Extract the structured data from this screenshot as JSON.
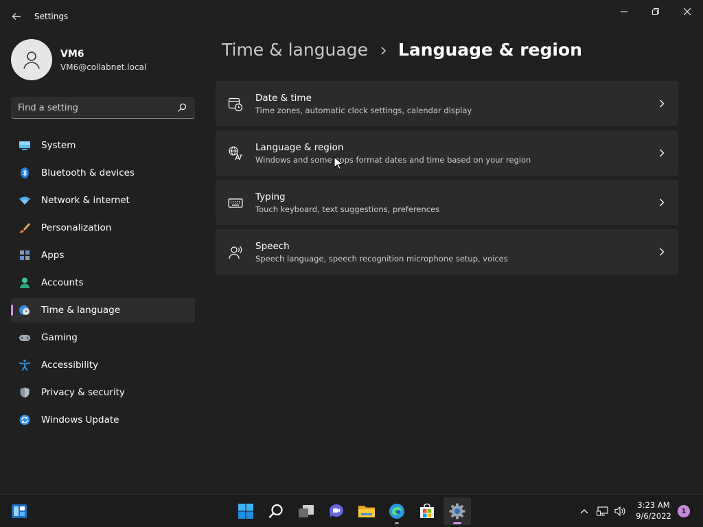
{
  "window": {
    "title": "Settings"
  },
  "profile": {
    "name": "VM6",
    "email": "VM6@collabnet.local"
  },
  "search": {
    "placeholder": "Find a setting"
  },
  "sidebar": {
    "items": [
      {
        "label": "System",
        "icon": "system-icon",
        "selected": false
      },
      {
        "label": "Bluetooth & devices",
        "icon": "bluetooth-icon",
        "selected": false
      },
      {
        "label": "Network & internet",
        "icon": "wifi-icon",
        "selected": false
      },
      {
        "label": "Personalization",
        "icon": "brush-icon",
        "selected": false
      },
      {
        "label": "Apps",
        "icon": "apps-icon",
        "selected": false
      },
      {
        "label": "Accounts",
        "icon": "person-icon",
        "selected": false
      },
      {
        "label": "Time & language",
        "icon": "globe-clock-icon",
        "selected": true
      },
      {
        "label": "Gaming",
        "icon": "gamepad-icon",
        "selected": false
      },
      {
        "label": "Accessibility",
        "icon": "accessibility-icon",
        "selected": false
      },
      {
        "label": "Privacy & security",
        "icon": "shield-icon",
        "selected": false
      },
      {
        "label": "Windows Update",
        "icon": "update-icon",
        "selected": false
      }
    ]
  },
  "breadcrumb": {
    "parent": "Time & language",
    "current": "Language & region"
  },
  "cards": [
    {
      "title": "Date & time",
      "description": "Time zones, automatic clock settings, calendar display",
      "icon": "calendar-clock-icon"
    },
    {
      "title": "Language & region",
      "description": "Windows and some apps format dates and time based on your region",
      "icon": "language-icon"
    },
    {
      "title": "Typing",
      "description": "Touch keyboard, text suggestions, preferences",
      "icon": "keyboard-icon"
    },
    {
      "title": "Speech",
      "description": "Speech language, speech recognition microphone setup, voices",
      "icon": "speech-icon"
    }
  ],
  "taskbar": {
    "apps": [
      "start-icon",
      "search-icon",
      "task-view-icon",
      "chat-icon",
      "file-explorer-icon",
      "edge-icon",
      "store-icon",
      "settings-icon"
    ],
    "active_app": "settings-icon",
    "clock_time": "3:23 AM",
    "clock_date": "9/6/2022",
    "notification_count": "1"
  },
  "colors": {
    "accent": "#d18fe6",
    "background": "#202020",
    "card": "#2b2b2b"
  }
}
